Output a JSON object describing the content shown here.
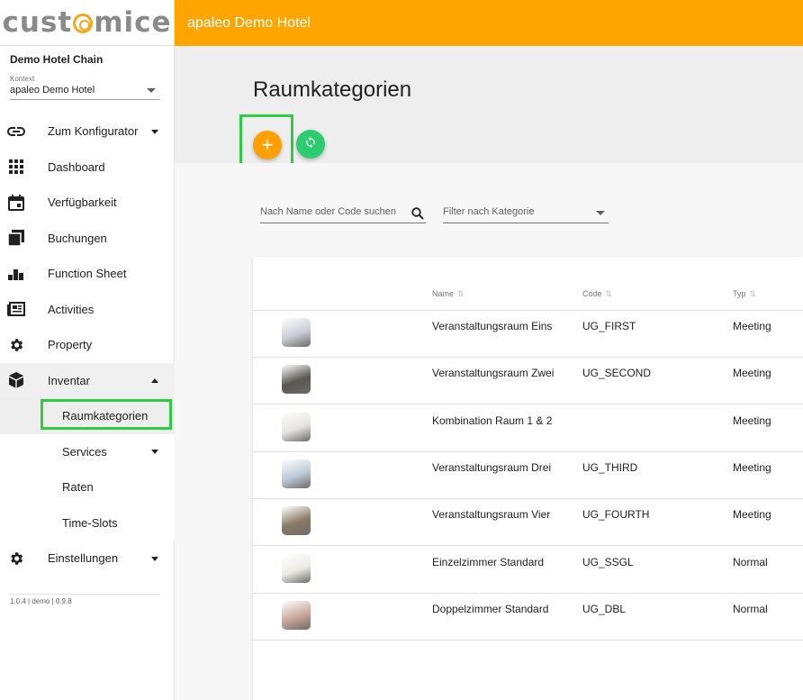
{
  "app": {
    "logo_text_a": "cust",
    "logo_text_b": "mice",
    "org_name": "Demo Hotel Chain",
    "context_label": "Kontext",
    "context_value": "apaleo Demo Hotel",
    "version": "1.0.4 | demo | 0.9.8"
  },
  "topbar": {
    "title": "apaleo Demo Hotel"
  },
  "nav": {
    "items": [
      {
        "label": "Zum Konfigurator",
        "icon": "link-icon"
      },
      {
        "label": "Dashboard",
        "icon": "grid-icon"
      },
      {
        "label": "Verfügbarkeit",
        "icon": "calendar-icon"
      },
      {
        "label": "Buchungen",
        "icon": "stack-icon"
      },
      {
        "label": "Function Sheet",
        "icon": "bar-chart-icon"
      },
      {
        "label": "Activities",
        "icon": "newspaper-icon"
      },
      {
        "label": "Property",
        "icon": "gear-icon"
      },
      {
        "label": "Inventar",
        "icon": "cube-icon"
      }
    ],
    "sub_items": [
      {
        "label": "Raumkategorien"
      },
      {
        "label": "Services"
      },
      {
        "label": "Raten"
      },
      {
        "label": "Time-Slots"
      }
    ],
    "settings": {
      "label": "Einstellungen",
      "icon": "gear-icon"
    }
  },
  "page": {
    "title": "Raumkategorien",
    "add_label": "+",
    "search_placeholder": "Nach Name oder Code suchen",
    "filter_placeholder": "Filter nach Kategorie"
  },
  "table": {
    "columns": [
      "Name",
      "Code",
      "Typ"
    ],
    "rows": [
      {
        "name": "Veranstaltungsraum Eins",
        "code": "UG_FIRST",
        "type": "Meeting",
        "thumb_color": "#c9cdd6"
      },
      {
        "name": "Veranstaltungsraum Zwei",
        "code": "UG_SECOND",
        "type": "Meeting",
        "thumb_color": "#5a5650"
      },
      {
        "name": "Kombination Raum 1 & 2",
        "code": "",
        "type": "Meeting",
        "thumb_color": "#e4e2de"
      },
      {
        "name": "Veranstaltungsraum Drei",
        "code": "UG_THIRD",
        "type": "Meeting",
        "thumb_color": "#bcc9d8"
      },
      {
        "name": "Veranstaltungsraum Vier",
        "code": "UG_FOURTH",
        "type": "Meeting",
        "thumb_color": "#8a7a66"
      },
      {
        "name": "Einzelzimmer Standard",
        "code": "UG_SSGL",
        "type": "Normal",
        "thumb_color": "#eeebe6"
      },
      {
        "name": "Doppelzimmer Standard",
        "code": "UG_DBL",
        "type": "Normal",
        "thumb_color": "#c9a79a"
      }
    ]
  },
  "colors": {
    "accent": "#ffa500",
    "sync": "#2ecc71",
    "highlight": "#2ecc40"
  }
}
